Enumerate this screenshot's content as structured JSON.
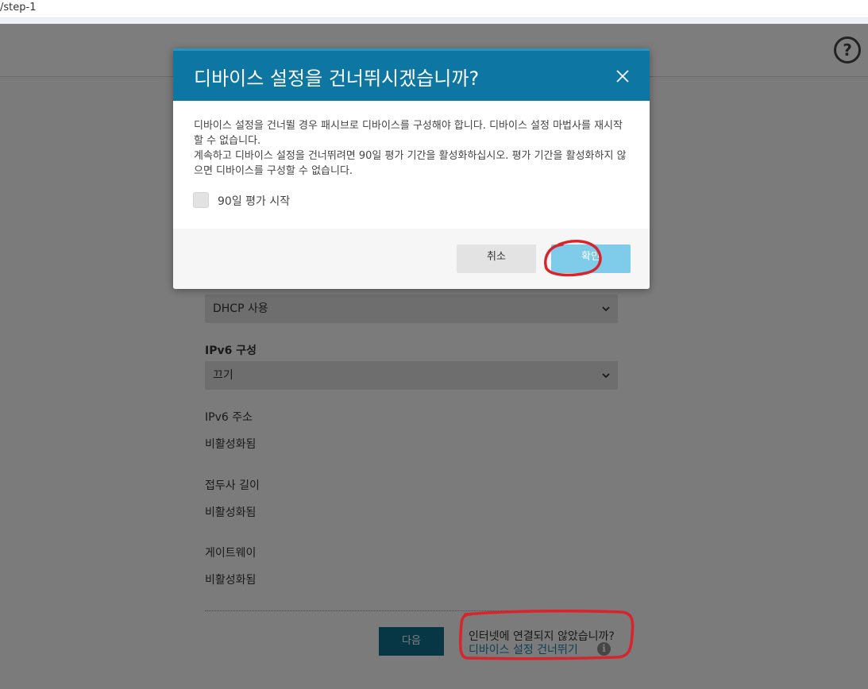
{
  "browser": {
    "url_fragment": "/step-1"
  },
  "header": {
    "help_label": "?"
  },
  "form": {
    "ipv4_select_value": "DHCP 사용",
    "ipv6_config_label": "IPv6 구성",
    "ipv6_select_value": "끄기",
    "ipv6_address_label": "IPv6 주소",
    "ipv6_address_value": "비활성화됨",
    "prefix_length_label": "접두사 길이",
    "prefix_length_value": "비활성화됨",
    "gateway_label": "게이트웨이",
    "gateway_value": "비활성화됨"
  },
  "footer": {
    "next_label": "다음",
    "offline_question": "인터넷에 연결되지 않았습니까?",
    "skip_link": "디바이스 설정 건너뛰기",
    "info_glyph": "i"
  },
  "modal": {
    "title": "디바이스 설정을 건너뛰시겠습니까?",
    "paragraph1": "디바이스 설정을 건너뛸 경우 패시브로 디바이스를 구성해야 합니다. 디바이스 설정 마법사를 재시작할 수 없습니다.",
    "paragraph2": "계속하고 디바이스 설정을 건너뛰려면 90일 평가 기간을 활성화하십시오. 평가 기간을 활성화하지 않으면 디바이스를 구성할 수 없습니다.",
    "checkbox_label": "90일 평가 시작",
    "cancel_label": "취소",
    "confirm_label": "확인"
  },
  "colors": {
    "modal_header": "#0d76a2",
    "confirm_button": "#7ecbea",
    "next_button": "#0e6c8a",
    "link": "#1a7fae",
    "annotation": "#d8242c"
  },
  "icons": {
    "chevron": "chevron-down-icon",
    "close": "close-icon",
    "info": "info-icon",
    "help": "help-icon"
  }
}
